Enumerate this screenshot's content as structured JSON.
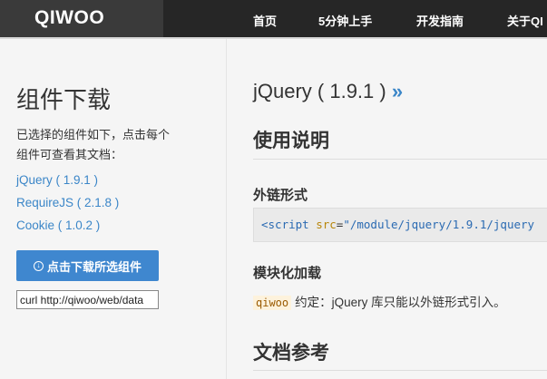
{
  "header": {
    "brand": "QIWOO",
    "nav": [
      "首页",
      "5分钟上手",
      "开发指南",
      "关于QI"
    ]
  },
  "sidebar": {
    "title": "组件下载",
    "description": "已选择的组件如下，点击每个组件可查看其文档：",
    "components": [
      "jQuery ( 1.9.1 )",
      "RequireJS ( 2.1.8 )",
      "Cookie ( 1.0.2 )"
    ],
    "download_button": "点击下载所选组件",
    "curl_value": "curl http://qiwoo/web/data"
  },
  "main": {
    "title": "jQuery ( 1.9.1 )",
    "title_arrow": "»",
    "usage_heading": "使用说明",
    "link_form_heading": "外链形式",
    "code": {
      "tag_open": "<script",
      "attr": "src",
      "eq": "=",
      "value": "\"/module/jquery/1.9.1/jquery"
    },
    "module_heading": "模块化加载",
    "note_code": "qiwoo",
    "note_text": "约定：jQuery 库只能以外链形式引入。",
    "docs_heading": "文档参考"
  },
  "colors": {
    "topbar": "#262626",
    "brand_box": "#3a3a3a",
    "link": "#3b86c8",
    "button": "#3f87cf"
  }
}
